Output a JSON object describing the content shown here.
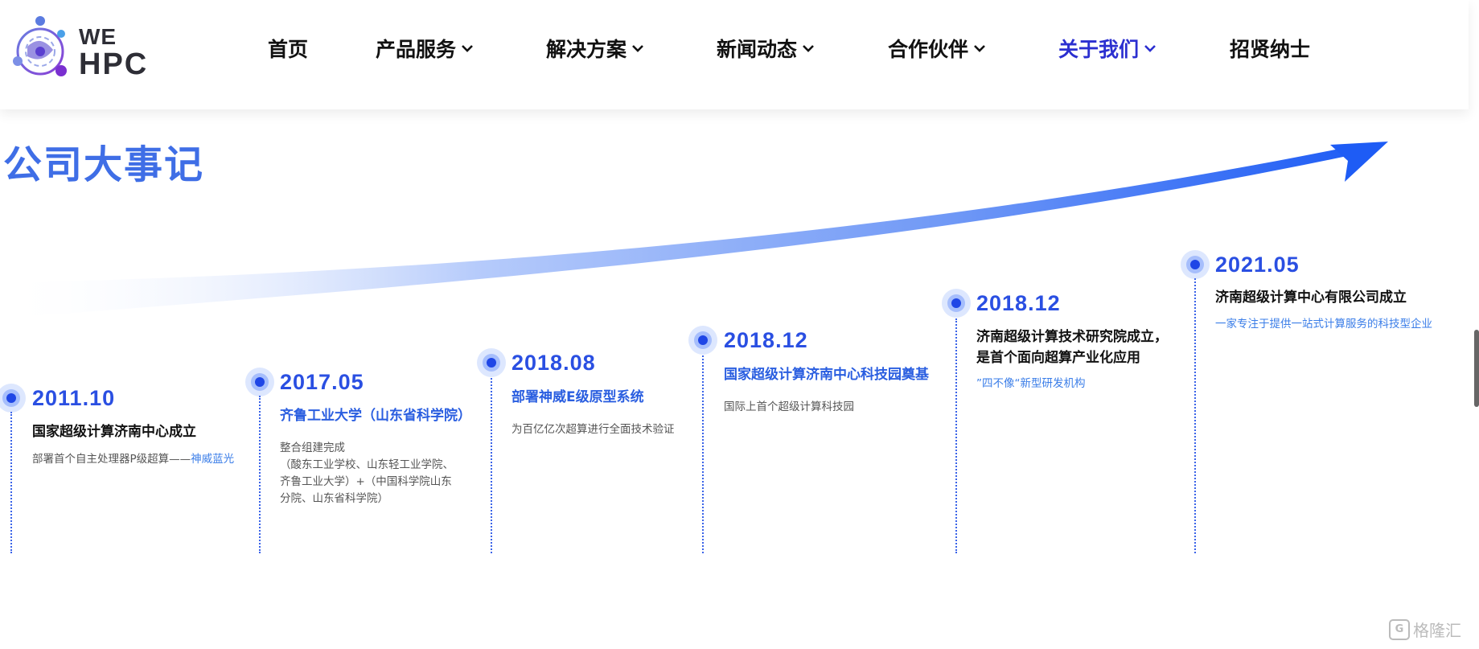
{
  "brand": {
    "line1": "WE",
    "line2": "HPC"
  },
  "nav": {
    "items": [
      {
        "label": "首页",
        "dropdown": false,
        "active": false
      },
      {
        "label": "产品服务",
        "dropdown": true,
        "active": false
      },
      {
        "label": "解决方案",
        "dropdown": true,
        "active": false
      },
      {
        "label": "新闻动态",
        "dropdown": true,
        "active": false
      },
      {
        "label": "合作伙伴",
        "dropdown": true,
        "active": false
      },
      {
        "label": "关于我们",
        "dropdown": true,
        "active": true
      },
      {
        "label": "招贤纳士",
        "dropdown": false,
        "active": false
      }
    ]
  },
  "section": {
    "title": "公司大事记"
  },
  "events": [
    {
      "year": "2011.10",
      "title": [
        "国家超级计算济南中心成立"
      ],
      "title_style": "dark",
      "desc": [
        "部署首个自主处理器P级超算——"
      ],
      "desc_highlight": "神威蓝光"
    },
    {
      "year": "2017.05",
      "title": [
        "齐鲁工业大学（山东省科学院）"
      ],
      "title_style": "blue",
      "desc": [
        "整合组建完成",
        "（酸东工业学校、山东轻工业学院、",
        "齐鲁工业大学）+（中国科学院山东",
        "分院、山东省科学院）"
      ]
    },
    {
      "year": "2018.08",
      "title": [
        "部署神威E级原型系统"
      ],
      "title_style": "blue",
      "desc": [
        "为百亿亿次超算进行全面技术验证"
      ]
    },
    {
      "year": "2018.12",
      "title": [
        "国家超级计算济南中心科技园奠基"
      ],
      "title_style": "blue",
      "desc": [
        "国际上首个超级计算科技园"
      ]
    },
    {
      "year": "2018.12",
      "title": [
        "济南超级计算技术研究院成立，",
        "是首个面向超算产业化应用"
      ],
      "title_style": "dark",
      "desc": [
        "”四不像“新型研发机构"
      ],
      "desc_style": "blue"
    },
    {
      "year": "2021.05",
      "title": [
        "济南超级计算中心有限公司成立"
      ],
      "title_style": "dark",
      "desc": [
        "一家专注于提供一站式计算服务的科技型企业"
      ],
      "desc_style": "blue"
    }
  ],
  "watermark": {
    "text": "格隆汇",
    "icon": "g-logo-icon"
  },
  "colors": {
    "accent": "#2b2fd0",
    "timeline_blue": "#2a4fe2",
    "arrow": "#1e5cf5"
  }
}
